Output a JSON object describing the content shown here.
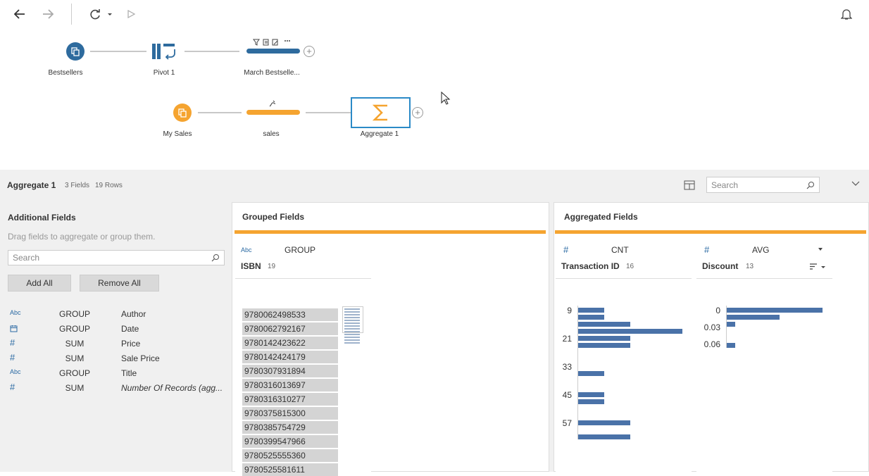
{
  "toolbar": {
    "back_icon": "arrow-left-icon",
    "forward_icon": "arrow-right-icon",
    "refresh_icon": "refresh-icon",
    "run_icon": "play-icon",
    "notify_icon": "bell-icon"
  },
  "flow": {
    "nodes": {
      "bestsellers": "Bestsellers",
      "pivot": "Pivot 1",
      "march": "March Bestselle...",
      "my_sales": "My Sales",
      "sales": "sales",
      "aggregate": "Aggregate 1"
    },
    "colors": {
      "blue": "#2e6b9e",
      "orange": "#f5a430",
      "selected_border": "#2b8ac7"
    }
  },
  "panel": {
    "title": "Aggregate 1",
    "fields_count": "3 Fields",
    "rows_count": "19 Rows",
    "search_placeholder": "Search"
  },
  "additional": {
    "title": "Additional Fields",
    "hint": "Drag fields to aggregate or group them.",
    "search_placeholder": "Search",
    "add_all": "Add All",
    "remove_all": "Remove All",
    "fields": [
      {
        "type": "Abc",
        "agg": "GROUP",
        "name": "Author"
      },
      {
        "type": "date",
        "agg": "GROUP",
        "name": "Date"
      },
      {
        "type": "#",
        "agg": "SUM",
        "name": "Price"
      },
      {
        "type": "#",
        "agg": "SUM",
        "name": "Sale Price"
      },
      {
        "type": "Abc",
        "agg": "GROUP",
        "name": "Title"
      },
      {
        "type": "#",
        "agg": "SUM",
        "name": "Number Of Records (agg..."
      }
    ]
  },
  "grouped": {
    "title": "Grouped Fields",
    "card": {
      "type": "Abc",
      "agg": "GROUP",
      "name": "ISBN",
      "count": "19",
      "values": [
        "9780062498533",
        "9780062792167",
        "9780142423622",
        "9780142424179",
        "9780307931894",
        "9780316013697",
        "9780316310277",
        "9780375815300",
        "9780385754729",
        "9780399547966",
        "9780525555360",
        "9780525581611"
      ]
    }
  },
  "aggregated": {
    "title": "Aggregated Fields",
    "cards": [
      {
        "type": "#",
        "agg": "CNT",
        "name": "Transaction ID",
        "count": "16",
        "axis_ticks": [
          "9",
          "21",
          "33",
          "45",
          "57"
        ],
        "bars": [
          0.25,
          0.25,
          0.5,
          1.0,
          0.5,
          0.5,
          0.25,
          0.25,
          0.25,
          0.5,
          0.5
        ]
      },
      {
        "type": "#",
        "agg": "AVG",
        "name": "Discount",
        "count": "13",
        "axis_ticks": [
          "0",
          "0.03",
          "0.06"
        ],
        "bars": [
          1.0,
          0.55,
          0.09,
          0.09
        ]
      }
    ]
  }
}
